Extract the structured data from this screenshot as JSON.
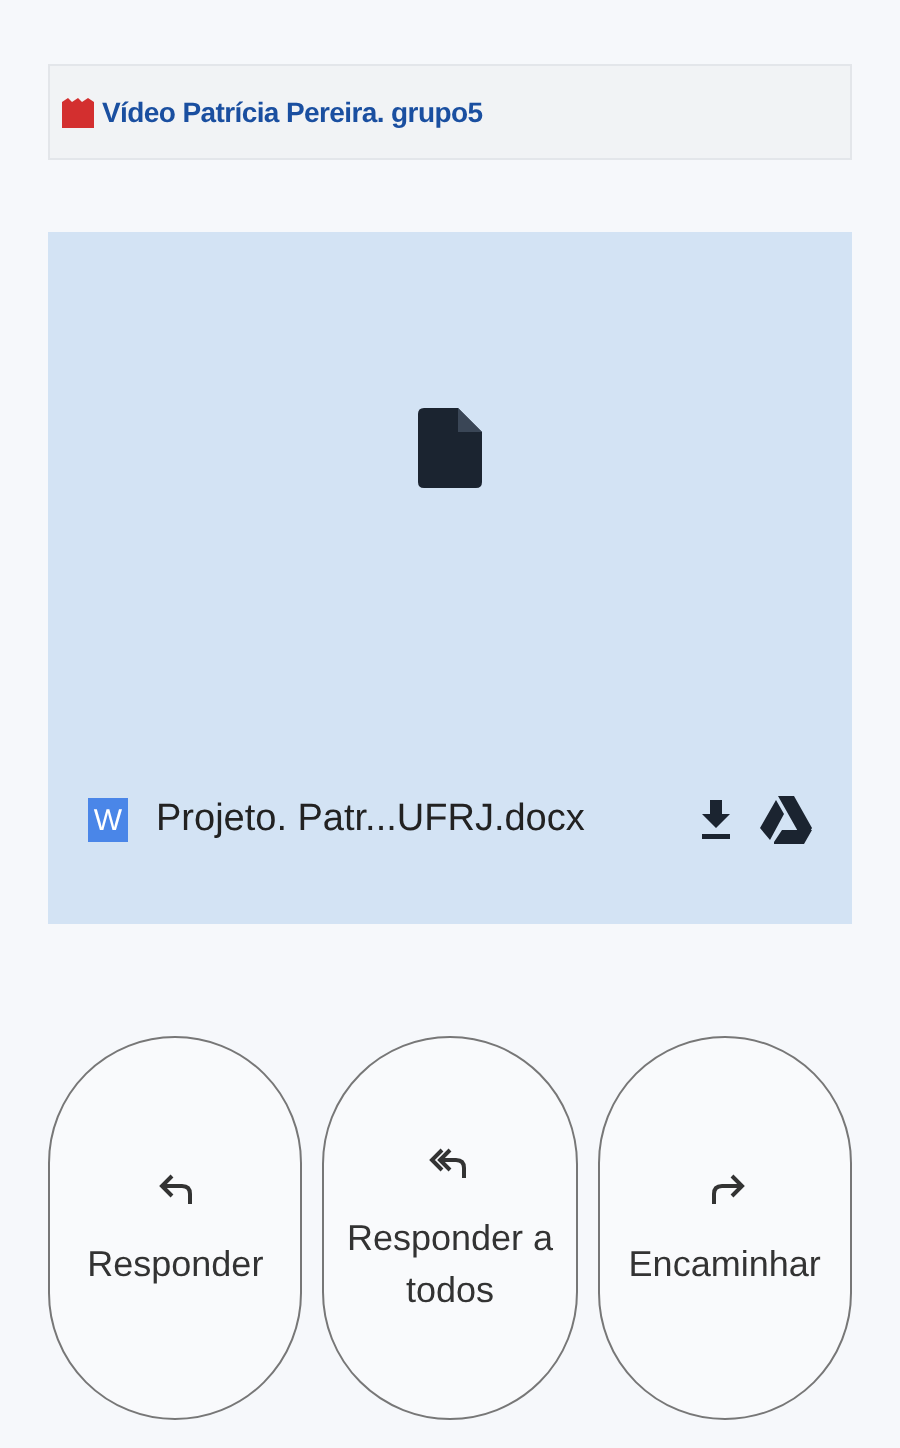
{
  "link": {
    "text": "Vídeo Patrícia Pereira. grupo5"
  },
  "attachment": {
    "file_type": "W",
    "file_name": "Projeto. Patr...UFRJ.docx"
  },
  "actions": [
    {
      "kind": "reply",
      "label": "Responder"
    },
    {
      "kind": "reply_all",
      "label": "Responder a todos"
    },
    {
      "kind": "forward",
      "label": "Encaminhar"
    }
  ]
}
